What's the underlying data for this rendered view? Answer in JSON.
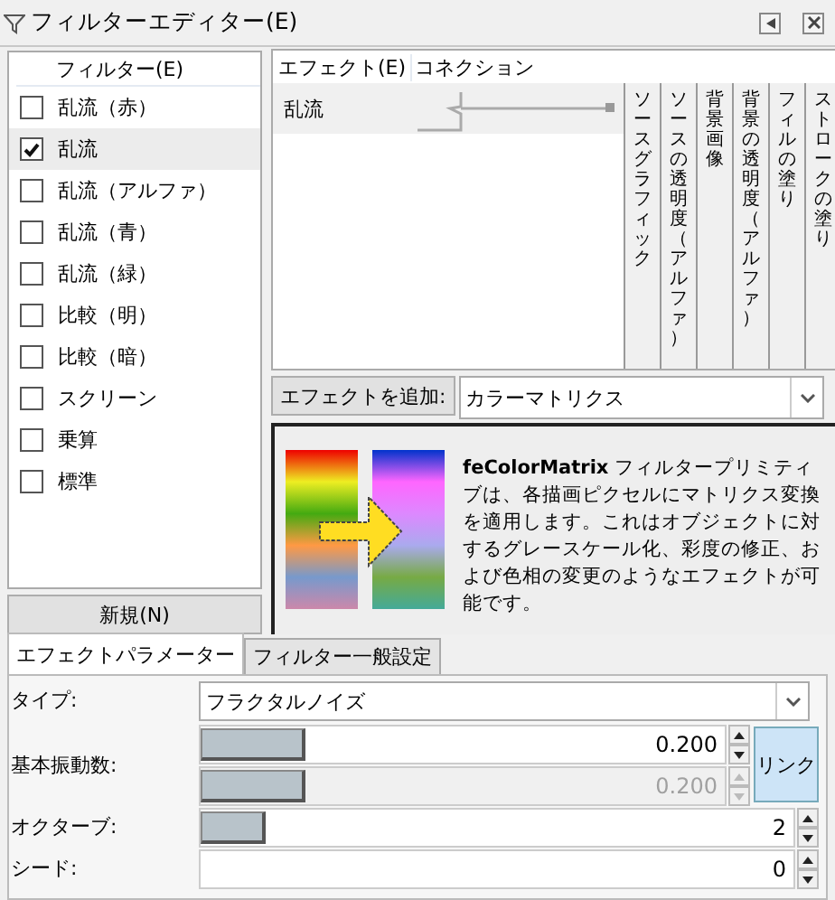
{
  "window": {
    "title": "フィルターエディター(E)"
  },
  "filters": {
    "header": "フィルター(E)",
    "items": [
      {
        "label": "乱流（赤）",
        "checked": false,
        "selected": false
      },
      {
        "label": "乱流",
        "checked": true,
        "selected": true
      },
      {
        "label": "乱流（アルファ）",
        "checked": false,
        "selected": false
      },
      {
        "label": "乱流（青）",
        "checked": false,
        "selected": false
      },
      {
        "label": "乱流（緑）",
        "checked": false,
        "selected": false
      },
      {
        "label": "比較（明）",
        "checked": false,
        "selected": false
      },
      {
        "label": "比較（暗）",
        "checked": false,
        "selected": false
      },
      {
        "label": "スクリーン",
        "checked": false,
        "selected": false
      },
      {
        "label": "乗算",
        "checked": false,
        "selected": false
      },
      {
        "label": "標準",
        "checked": false,
        "selected": false
      }
    ],
    "new_button": "新規(N)"
  },
  "effects": {
    "header": "エフェクト(E)",
    "connections_header": "コネクション",
    "items": [
      {
        "label": "乱流",
        "selected": true
      }
    ],
    "inputs": [
      "ソースグラフィック",
      "ソースの透明度（アルファ）",
      "背景画像",
      "背景の透明度（アルファ）",
      "フィルの塗り",
      "ストロークの塗り"
    ]
  },
  "add_effect": {
    "button": "エフェクトを追加:",
    "value": "カラーマトリクス"
  },
  "description": "**feColorMatrix** フィルタープリミティブは、各描画ピクセルにマトリクス変換を適用します。これはオブジェクトに対するグレースケール化、彩度の修正、および色相の変更のようなエフェクトが可能です。",
  "tabs": [
    {
      "label": "エフェクトパラメーター",
      "selected": true
    },
    {
      "label": "フィルター一般設定",
      "selected": false
    }
  ],
  "params": [
    {
      "kind": "select",
      "label": "タイプ:",
      "value": "フラクタルノイズ"
    },
    {
      "kind": "pair",
      "label": "基本振動数:",
      "sliders": [
        {
          "level": 0.2,
          "reading": "0.200",
          "disabled": false
        },
        {
          "level": 0.2,
          "reading": "0.200",
          "disabled": true
        }
      ],
      "link": {
        "label": "リンク",
        "on": true
      }
    },
    {
      "kind": "slider",
      "label": "オクターブ:",
      "level": 0.11,
      "reading": "2"
    },
    {
      "kind": "slider",
      "label": "シード:",
      "reading": "0"
    }
  ]
}
